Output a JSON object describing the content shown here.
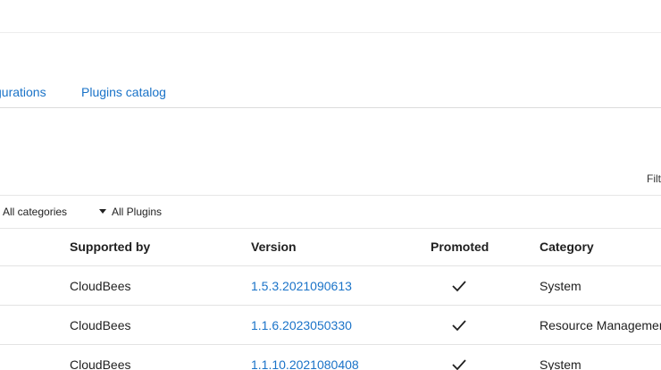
{
  "tabs": [
    {
      "label": "gurations"
    },
    {
      "label": "Plugins catalog"
    }
  ],
  "filter": {
    "label": "Filt"
  },
  "filters": {
    "category": "All categories",
    "plugins": "All Plugins"
  },
  "table": {
    "headers": {
      "supported_by": "Supported by",
      "version": "Version",
      "promoted": "Promoted",
      "category": "Category"
    },
    "rows": [
      {
        "supported_by": "CloudBees",
        "version": "1.5.3.2021090613",
        "promoted": true,
        "category": "System"
      },
      {
        "supported_by": "CloudBees",
        "version": "1.1.6.2023050330",
        "promoted": true,
        "category": "Resource Managemen"
      },
      {
        "supported_by": "CloudBees",
        "version": "1.1.10.2021080408",
        "promoted": true,
        "category": "System"
      }
    ]
  },
  "icons": {
    "promoted": "checkmark-icon",
    "dropdown": "caret-down-icon"
  },
  "colors": {
    "link": "#1a73c8",
    "text": "#1f1f1f",
    "divider": "#e3e3e3"
  }
}
